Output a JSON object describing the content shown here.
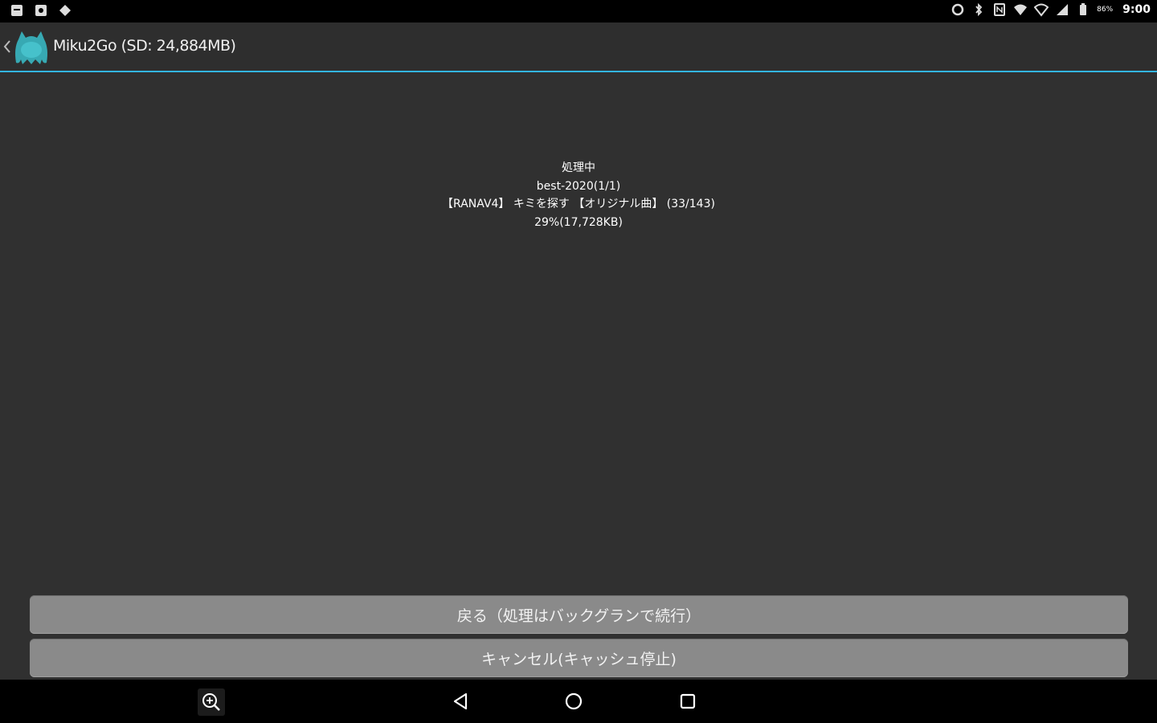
{
  "status_bar": {
    "time": "9:00",
    "battery_percent": "86%",
    "left_icons": [
      "notification-icon",
      "image-icon",
      "settings-icon"
    ],
    "right_icons": [
      "sync-icon",
      "bluetooth-icon",
      "nfc-icon",
      "wifi-icon",
      "wifi-alt-icon",
      "signal-icon",
      "battery-icon"
    ]
  },
  "action_bar": {
    "title": "Miku2Go (SD: 24,884MB)",
    "accent_color": "#33b5e5"
  },
  "progress": {
    "status": "処理中",
    "playlist": "best-2020(1/1)",
    "track": "【RANAV4】 キミを探す 【オリジナル曲】 (33/143)",
    "percent_size": "29%(17,728KB)"
  },
  "buttons": {
    "back_label": "戻る（処理はバックグランで続行）",
    "cancel_label": "キャンセル(キャッシュ停止)"
  },
  "nav_bar": {
    "icons": [
      "zoom-icon",
      "back-icon",
      "home-icon",
      "recent-apps-icon"
    ]
  }
}
